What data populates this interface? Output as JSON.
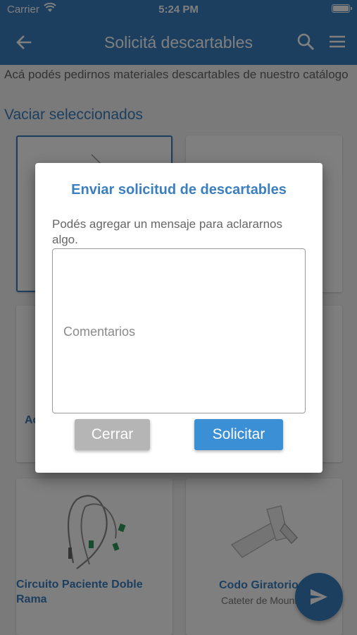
{
  "status_bar": {
    "carrier": "Carrier",
    "time": "5:24 PM"
  },
  "app_bar": {
    "title": "Solicitá descartables"
  },
  "intro": "Acá podés pedirnos materiales descartables de nuestro catálogo",
  "clear_selected": "Vaciar seleccionados",
  "cards": [
    {
      "name": "Ac",
      "subtitle": ""
    },
    {
      "name": "Circuito Paciente Doble Rama",
      "subtitle": ""
    },
    {
      "name": "Codo Giratorio",
      "subtitle": "Cateter de Mount"
    }
  ],
  "dialog": {
    "title": "Enviar solicitud de descartables",
    "message": "Podés agregar un mensaje para aclararnos algo.",
    "comments_placeholder": "Comentarios",
    "close_label": "Cerrar",
    "submit_label": "Solicitar"
  },
  "colors": {
    "primary": "#3b7fbf",
    "button_primary": "#3b8fd4",
    "button_disabled": "#b5b5b5"
  },
  "icons": {
    "back": "arrow-left-icon",
    "search": "search-icon",
    "menu": "menu-icon",
    "send": "send-icon",
    "wifi": "wifi-icon",
    "battery": "battery-icon"
  }
}
